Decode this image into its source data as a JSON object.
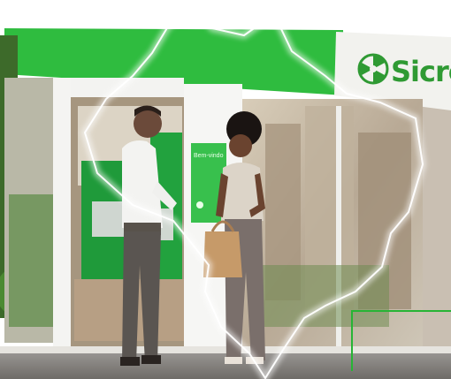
{
  "image": {
    "subject": "man-and-woman-talking-at-bank-branch-entrance",
    "brand": {
      "name": "Sicred",
      "color": "#2f9a33",
      "logo_icon": "pinwheel-logo-icon"
    },
    "kiosk_screen_text": "Bem-vindo",
    "overlay": "brazil-map-outline-glow",
    "accent_color": "#27b435"
  }
}
